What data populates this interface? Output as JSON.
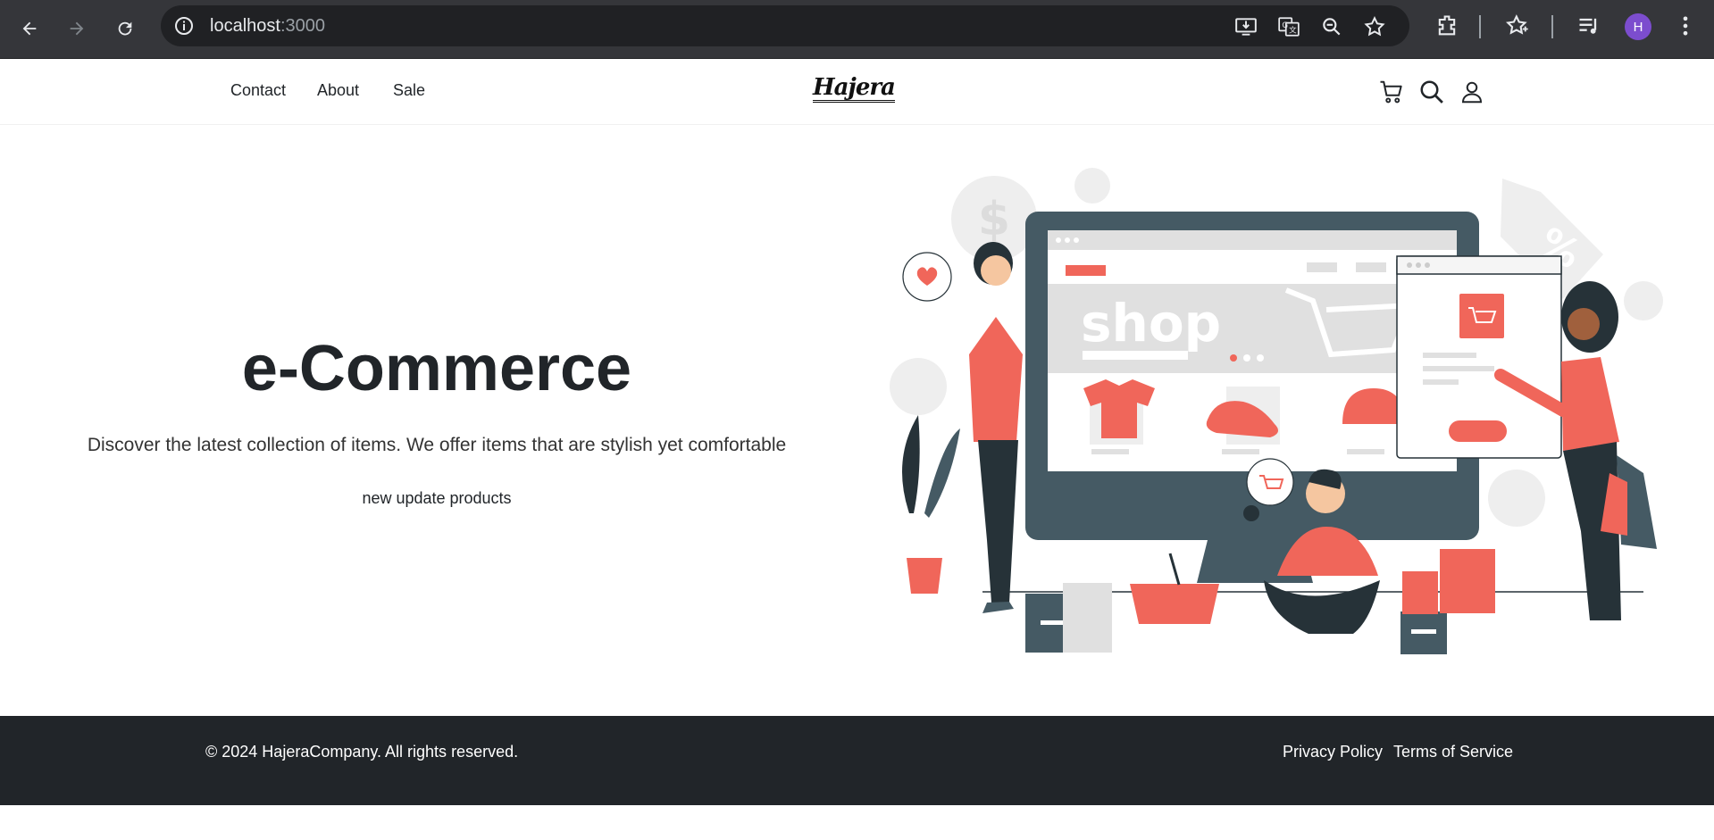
{
  "browser": {
    "url_host": "localhost",
    "url_port": ":3000",
    "profile_initial": "H",
    "icons": [
      "back-icon",
      "forward-icon",
      "reload-icon",
      "site-info-icon",
      "install-app-icon",
      "translate-icon",
      "zoom-icon",
      "bookmark-star-icon",
      "extensions-icon",
      "bookmarks-icon",
      "media-icon",
      "profile-avatar",
      "menu-icon"
    ]
  },
  "header": {
    "nav": [
      "Contact",
      "About",
      "Sale"
    ],
    "logo": "Hajera",
    "icons": [
      "cart-icon",
      "search-icon",
      "user-icon"
    ]
  },
  "hero": {
    "title": "e-Commerce",
    "subtitle": "Discover the latest collection of items. We offer items that are stylish yet comfortable",
    "button": "new update products",
    "illustration_text": "shop"
  },
  "footer": {
    "copyright": "© 2024 HajeraCompany. All rights reserved.",
    "links": [
      "Privacy Policy",
      "Terms of Service"
    ]
  },
  "colors": {
    "accent": "#f0665a",
    "dark": "#263238",
    "slate": "#455a64",
    "footer_bg": "#212529",
    "chrome_bg": "#35363a"
  }
}
